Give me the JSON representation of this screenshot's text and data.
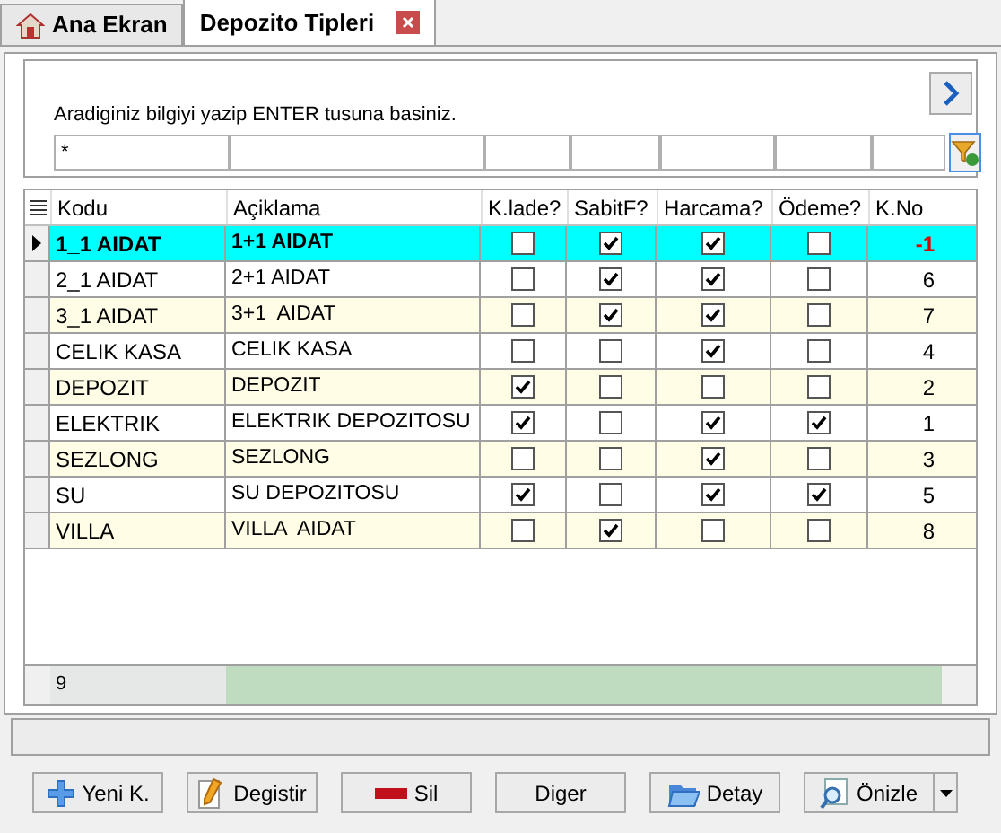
{
  "tabs": [
    {
      "label": "Ana Ekran",
      "selected": false,
      "closable": false
    },
    {
      "label": "Depozito Tipleri",
      "selected": true,
      "closable": true
    }
  ],
  "search": {
    "hint": "Aradiginiz bilgiyi yazip ENTER tusuna basiniz.",
    "filter_value": "*"
  },
  "table": {
    "columns": [
      "Kodu",
      "Açiklama",
      "K.lade?",
      "SabitF?",
      "Harcama?",
      "Ödeme?",
      "K.No"
    ],
    "rows": [
      {
        "kodu": "1_1 AIDAT",
        "aciklama": "1+1 AIDAT",
        "klade": false,
        "sabitf": true,
        "harcama": true,
        "odeme": false,
        "kno": "-1",
        "selected": true
      },
      {
        "kodu": "2_1 AIDAT",
        "aciklama": "2+1 AIDAT",
        "klade": false,
        "sabitf": true,
        "harcama": true,
        "odeme": false,
        "kno": "6",
        "selected": false
      },
      {
        "kodu": "3_1 AIDAT",
        "aciklama": "3+1  AIDAT",
        "klade": false,
        "sabitf": true,
        "harcama": true,
        "odeme": false,
        "kno": "7",
        "selected": false
      },
      {
        "kodu": "CELIK KASA",
        "aciklama": "CELIK KASA",
        "klade": false,
        "sabitf": false,
        "harcama": true,
        "odeme": false,
        "kno": "4",
        "selected": false
      },
      {
        "kodu": "DEPOZIT",
        "aciklama": "DEPOZIT",
        "klade": true,
        "sabitf": false,
        "harcama": false,
        "odeme": false,
        "kno": "2",
        "selected": false
      },
      {
        "kodu": "ELEKTRIK",
        "aciklama": "ELEKTRIK DEPOZITOSU",
        "klade": true,
        "sabitf": false,
        "harcama": true,
        "odeme": true,
        "kno": "1",
        "selected": false
      },
      {
        "kodu": "SEZLONG",
        "aciklama": "SEZLONG",
        "klade": false,
        "sabitf": false,
        "harcama": true,
        "odeme": false,
        "kno": "3",
        "selected": false
      },
      {
        "kodu": "SU",
        "aciklama": "SU DEPOZITOSU",
        "klade": true,
        "sabitf": false,
        "harcama": true,
        "odeme": true,
        "kno": "5",
        "selected": false
      },
      {
        "kodu": "VILLA",
        "aciklama": "VILLA  AIDAT",
        "klade": false,
        "sabitf": true,
        "harcama": false,
        "odeme": false,
        "kno": "8",
        "selected": false
      }
    ],
    "footer_count": "9"
  },
  "buttons": [
    {
      "label": "Yeni K.",
      "kind": "add"
    },
    {
      "label": "Degistir",
      "kind": "edit"
    },
    {
      "label": "Sil",
      "kind": "delete"
    },
    {
      "label": "Diger",
      "kind": "plain"
    },
    {
      "label": "Detay",
      "kind": "folder"
    },
    {
      "label": "Önizle",
      "kind": "preview"
    }
  ]
}
